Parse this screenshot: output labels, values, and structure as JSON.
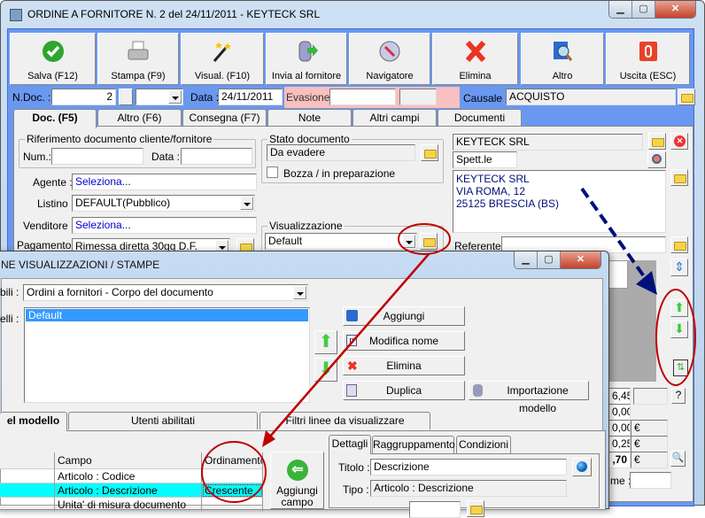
{
  "main_window": {
    "title": "ORDINE A FORNITORE N. 2  del 24/11/2011 - KEYTECK SRL",
    "toolbar": [
      {
        "label": "Salva (F12)",
        "icon": "check-icon"
      },
      {
        "label": "Stampa (F9)",
        "icon": "printer-icon"
      },
      {
        "label": "Visual. (F10)",
        "icon": "magic-wand-icon"
      },
      {
        "label": "Invia al fornitore",
        "icon": "database-send-icon"
      },
      {
        "label": "Navigatore",
        "icon": "compass-icon"
      },
      {
        "label": "Elimina",
        "icon": "red-x-icon"
      },
      {
        "label": "Altro",
        "icon": "book-search-icon"
      },
      {
        "label": "Uscita (ESC)",
        "icon": "power-icon"
      }
    ],
    "header": {
      "ndoc_label": "N.Doc. :",
      "ndoc_value": "2",
      "data_label": "Data :",
      "data_value": "24/11/2011",
      "evasione_label": "Evasione:",
      "causale_label": "Causale :",
      "causale_value": "ACQUISTO"
    },
    "tabs": [
      "Doc. (F5)",
      "Altro (F6)",
      "Consegna (F7)",
      "Note",
      "Altri campi",
      "Documenti"
    ],
    "riferimento": {
      "group_label": "Riferimento documento cliente/fornitore",
      "num_label": "Num.:",
      "data_label": "Data :"
    },
    "agente_label": "Agente :",
    "agente_value": "Seleziona...",
    "listino_label": "Listino :",
    "listino_value": "DEFAULT(Pubblico)",
    "venditore_label": "Venditore :",
    "venditore_value": "Seleziona...",
    "pagamento_label": "Pagamento :",
    "pagamento_value": "Rimessa diretta 30gg D.F.",
    "stato": {
      "group_label": "Stato documento",
      "value": "Da evadere",
      "bozza_label": "Bozza / in preparazione"
    },
    "visualizzazione": {
      "group_label": "Visualizzazione",
      "value": "Default"
    },
    "fornitore": {
      "name": "KEYTECK SRL",
      "title": "Spett.le",
      "address": [
        "KEYTECK SRL",
        "VIA ROMA, 12",
        "25125 BRESCIA (BS)"
      ],
      "referente_label": "Referente"
    },
    "totals": {
      "r1": "6,45",
      "help": "?",
      "r2": "0,00",
      "r3": "0,00",
      "r4": "0,25",
      "r5": ",70",
      "currency": "€",
      "nome_label": "me :"
    }
  },
  "dialog": {
    "title": "NE VISUALIZZAZIONI / STAMPE",
    "tipo_label": "bili :",
    "tipo_value": "Ordini a fornitori - Corpo del documento",
    "modelli_label": "elli :",
    "modelli": [
      "Default"
    ],
    "buttons": {
      "aggiungi": "Aggiungi",
      "modifica": "Modifica nome",
      "elimina": "Elimina",
      "duplica": "Duplica",
      "importazione": "Importazione modello"
    },
    "tabs": [
      "el modello",
      "Utenti abilitati",
      "Filtri linee da visualizzare"
    ],
    "grid": {
      "headers": [
        "",
        "Campo",
        "Ordinamento"
      ],
      "rows": [
        {
          "campo": "Articolo : Codice",
          "ordinamento": ""
        },
        {
          "campo": "Articolo : Descrizione",
          "ordinamento": "Crescente"
        },
        {
          "campo": "Unita' di misura documento",
          "ordinamento": ""
        }
      ]
    },
    "aggiungi_campo": "Aggiungi campo",
    "detail_tabs": [
      "Dettagli",
      "Raggruppamento",
      "Condizioni"
    ],
    "titolo_label": "Titolo :",
    "titolo_value": "Descrizione",
    "tipo2_label": "Tipo :",
    "tipo2_value": "Articolo : Descrizione"
  },
  "colors": {
    "frame_blue": "#6a98f0",
    "evasione_pink": "#f8c0c0",
    "selection": "#3399ff",
    "row_cyan": "#00ffff",
    "annotation_red": "#c00000",
    "annotation_navy": "#00107a"
  }
}
